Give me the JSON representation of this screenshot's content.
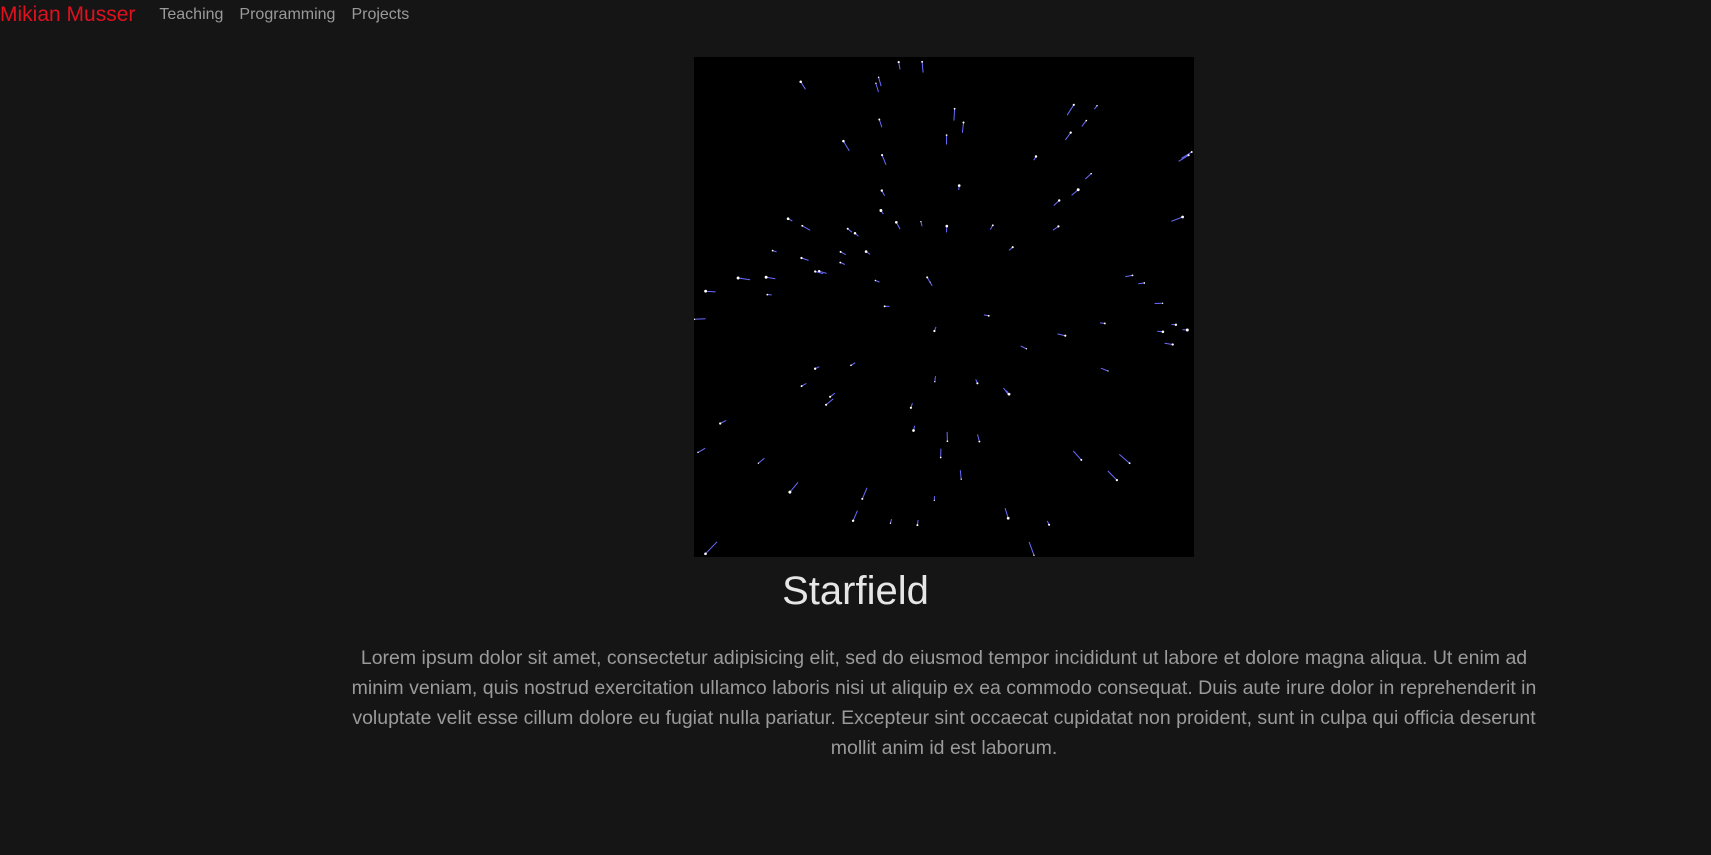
{
  "nav": {
    "brand": "Mikian Musser",
    "links": [
      "Teaching",
      "Programming",
      "Projects"
    ]
  },
  "main": {
    "title": "Starfield",
    "description": "Lorem ipsum dolor sit amet, consectetur adipisicing elit, sed do eiusmod tempor incididunt ut labore et dolore magna aliqua. Ut enim ad minim veniam, quis nostrud exercitation ullamco laboris nisi ut aliquip ex ea commodo consequat. Duis aute irure dolor in reprehenderit in voluptate velit esse cillum dolore eu fugiat nulla pariatur. Excepteur sint occaecat cupidatat non proident, sunt in culpa qui officia deserunt mollit anim id est laborum."
  },
  "colors": {
    "brand": "#e0101e",
    "background": "#151515",
    "canvas": "#000000",
    "star_trail": "#6a6aff",
    "star_head": "#ffffff"
  }
}
